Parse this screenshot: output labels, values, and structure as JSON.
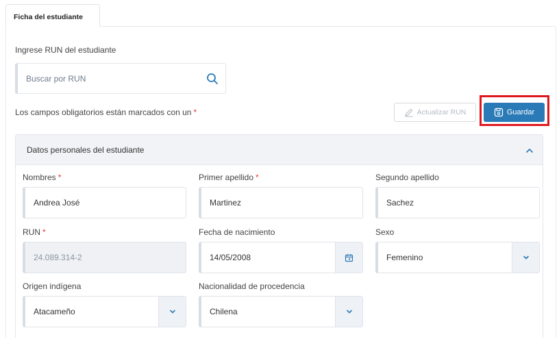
{
  "tab": {
    "label": "Ficha del estudiante"
  },
  "search": {
    "label": "Ingrese RUN del estudiante",
    "placeholder": "Buscar por RUN"
  },
  "notice": {
    "text": "Los campos obligatorios están marcados con un",
    "marker": "*"
  },
  "actions": {
    "update_label": "Actualizar RUN",
    "save_label": "Guardar"
  },
  "section": {
    "title": "Datos personales del estudiante",
    "fields": {
      "nombres": {
        "label": "Nombres",
        "required": "*",
        "value": "Andrea José"
      },
      "primer_apellido": {
        "label": "Primer apellido",
        "required": "*",
        "value": "Martinez"
      },
      "segundo_apellido": {
        "label": "Segundo apellido",
        "value": "Sachez"
      },
      "run": {
        "label": "RUN",
        "required": "*",
        "value": "24.089.314-2"
      },
      "fecha_nacimiento": {
        "label": "Fecha de nacimiento",
        "value": "14/05/2008"
      },
      "sexo": {
        "label": "Sexo",
        "value": "Femenino"
      },
      "origen_indigena": {
        "label": "Origen indígena",
        "value": "Atacameño"
      },
      "nacionalidad": {
        "label": "Nacionalidad de procedencia",
        "value": "Chilena"
      }
    }
  },
  "colors": {
    "accent": "#2a7ab7",
    "required": "#e53935",
    "highlight": "#e0161e"
  },
  "icons": [
    "search-icon",
    "edit-icon",
    "save-icon",
    "chevron-up-icon",
    "calendar-icon",
    "chevron-down-icon"
  ]
}
